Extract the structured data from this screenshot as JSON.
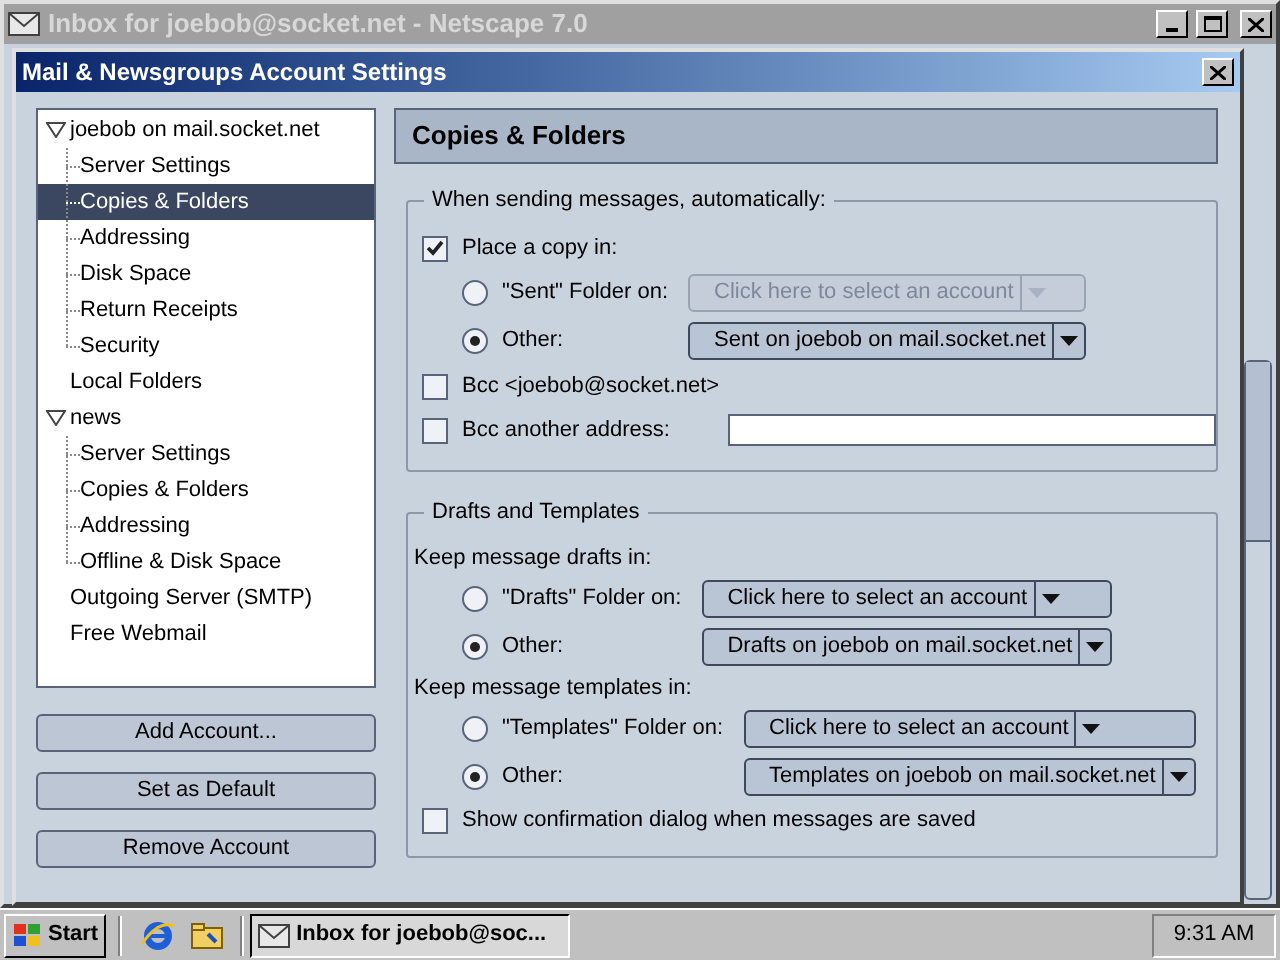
{
  "background_window": {
    "title": "Inbox for joebob@socket.net - Netscape 7.0"
  },
  "dialog": {
    "title": "Mail & Newsgroups Account Settings"
  },
  "account_tree": [
    {
      "label": "joebob on mail.socket.net",
      "selected": false,
      "expanded": true,
      "children": [
        {
          "label": "Server Settings",
          "selected": false
        },
        {
          "label": "Copies & Folders",
          "selected": true
        },
        {
          "label": "Addressing",
          "selected": false
        },
        {
          "label": "Disk Space",
          "selected": false
        },
        {
          "label": "Return Receipts",
          "selected": false
        },
        {
          "label": "Security",
          "selected": false
        }
      ]
    },
    {
      "label": "Local Folders",
      "selected": false
    },
    {
      "label": "news",
      "selected": false,
      "expanded": true,
      "children": [
        {
          "label": "Server Settings",
          "selected": false
        },
        {
          "label": "Copies & Folders",
          "selected": false
        },
        {
          "label": "Addressing",
          "selected": false
        },
        {
          "label": "Offline & Disk Space",
          "selected": false
        }
      ]
    },
    {
      "label": "Outgoing Server (SMTP)",
      "selected": false
    },
    {
      "label": "Free Webmail",
      "selected": false
    }
  ],
  "account_buttons": [
    "Add Account...",
    "Set as Default",
    "Remove Account"
  ],
  "page_title": "Copies & Folders",
  "sending": {
    "legend": "When sending messages, automatically:",
    "place_copy": {
      "label": "Place a copy in:",
      "checked": true
    },
    "options": [
      {
        "label": "\"Sent\" Folder on:",
        "selected": false,
        "dropdown": "Click here to select an account",
        "disabled": true
      },
      {
        "label": "Other:",
        "selected": true,
        "dropdown": "Sent on joebob on mail.socket.net",
        "disabled": false
      }
    ],
    "bcc_self": {
      "label": "Bcc <joebob@socket.net>",
      "checked": false
    },
    "bcc_other": {
      "label": "Bcc another address:",
      "checked": false
    }
  },
  "drafts_templates": {
    "legend": "Drafts and Templates",
    "groups": [
      {
        "label": "Keep message drafts in:",
        "options": [
          {
            "label": "\"Drafts\" Folder on:",
            "selected": false,
            "dropdown": "Click here to select an account",
            "disabled": false
          },
          {
            "label": "Other:",
            "selected": true,
            "dropdown": "Drafts on joebob on mail.socket.net",
            "disabled": false
          }
        ]
      },
      {
        "label": "Keep message templates in:",
        "options": [
          {
            "label": "\"Templates\" Folder on:",
            "selected": false,
            "dropdown": "Click here to select an account",
            "disabled": false
          },
          {
            "label": "Other:",
            "selected": true,
            "dropdown": "Templates on joebob on mail.socket.net",
            "disabled": false
          }
        ]
      }
    ],
    "confirm": {
      "label": "Show confirmation dialog when messages are saved",
      "checked": false
    }
  },
  "taskbar": {
    "start": "Start",
    "tasks": [
      "Inbox for joebob@soc..."
    ],
    "clock": "9:31 AM"
  }
}
